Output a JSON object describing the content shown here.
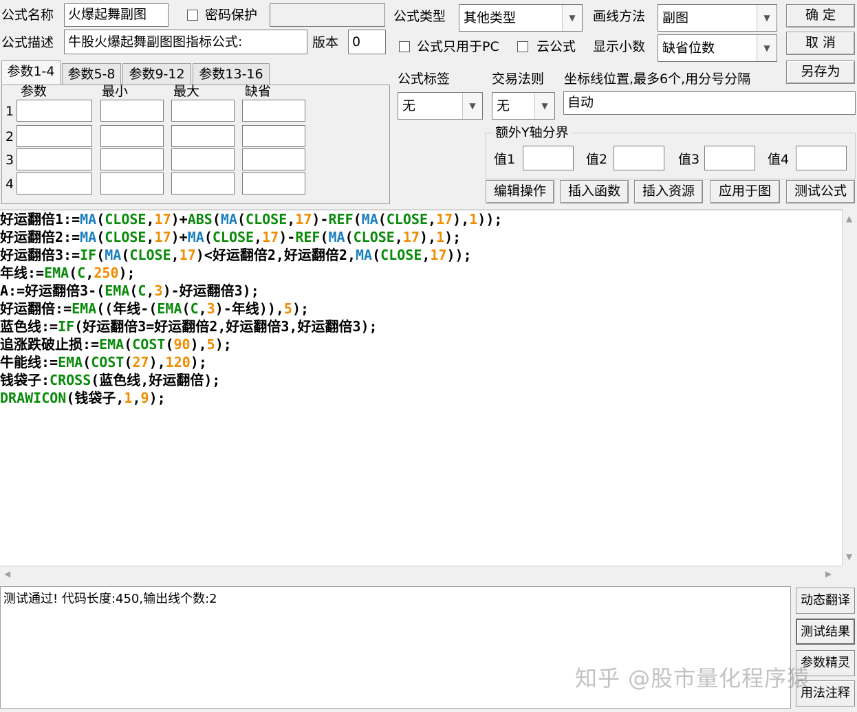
{
  "top": {
    "name_label": "公式名称",
    "name_value": "火爆起舞副图",
    "password_label": "密码保护",
    "password_value": "",
    "desc_label": "公式描述",
    "desc_value": "牛股火爆起舞副图图指标公式:",
    "version_label": "版本",
    "version_value": "0",
    "type_label": "公式类型",
    "type_value": "其他类型",
    "draw_label": "画线方法",
    "draw_value": "副图",
    "pc_only_label": "公式只用于PC",
    "cloud_label": "云公式",
    "decimals_label": "显示小数",
    "decimals_value": "缺省位数",
    "ok_label": "确 定",
    "cancel_label": "取 消",
    "saveas_label": "另存为"
  },
  "tabs": [
    "参数1-4",
    "参数5-8",
    "参数9-12",
    "参数13-16"
  ],
  "params": {
    "headers": [
      "参数",
      "最小",
      "最大",
      "缺省"
    ],
    "rows": [
      "1",
      "2",
      "3",
      "4"
    ]
  },
  "right": {
    "tag_label": "公式标签",
    "tag_value": "无",
    "trade_label": "交易法则",
    "trade_value": "无",
    "coord_label": "坐标线位置,最多6个,用分号分隔",
    "coord_value": "自动",
    "extra_y_label": "额外Y轴分界",
    "v1": "值1",
    "v2": "值2",
    "v3": "值3",
    "v4": "值4"
  },
  "actions": [
    "编辑操作",
    "插入函数",
    "插入资源",
    "应用于图",
    "测试公式"
  ],
  "code_lines": [
    [
      [
        "t",
        "好运翻倍1:="
      ],
      [
        "f2",
        "MA"
      ],
      [
        "t",
        "("
      ],
      [
        "f",
        "CLOSE"
      ],
      [
        "t",
        ","
      ],
      [
        "n",
        "17"
      ],
      [
        "t",
        ")+"
      ],
      [
        "f",
        "ABS"
      ],
      [
        "t",
        "("
      ],
      [
        "f2",
        "MA"
      ],
      [
        "t",
        "("
      ],
      [
        "f",
        "CLOSE"
      ],
      [
        "t",
        ","
      ],
      [
        "n",
        "17"
      ],
      [
        "t",
        ")-"
      ],
      [
        "f",
        "REF"
      ],
      [
        "t",
        "("
      ],
      [
        "f2",
        "MA"
      ],
      [
        "t",
        "("
      ],
      [
        "f",
        "CLOSE"
      ],
      [
        "t",
        ","
      ],
      [
        "n",
        "17"
      ],
      [
        "t",
        "),"
      ],
      [
        "n",
        "1"
      ],
      [
        "t",
        "));"
      ]
    ],
    [
      [
        "t",
        "好运翻倍2:="
      ],
      [
        "f2",
        "MA"
      ],
      [
        "t",
        "("
      ],
      [
        "f",
        "CLOSE"
      ],
      [
        "t",
        ","
      ],
      [
        "n",
        "17"
      ],
      [
        "t",
        ")+"
      ],
      [
        "f2",
        "MA"
      ],
      [
        "t",
        "("
      ],
      [
        "f",
        "CLOSE"
      ],
      [
        "t",
        ","
      ],
      [
        "n",
        "17"
      ],
      [
        "t",
        ")-"
      ],
      [
        "f",
        "REF"
      ],
      [
        "t",
        "("
      ],
      [
        "f2",
        "MA"
      ],
      [
        "t",
        "("
      ],
      [
        "f",
        "CLOSE"
      ],
      [
        "t",
        ","
      ],
      [
        "n",
        "17"
      ],
      [
        "t",
        "),"
      ],
      [
        "n",
        "1"
      ],
      [
        "t",
        ");"
      ]
    ],
    [
      [
        "t",
        "好运翻倍3:="
      ],
      [
        "f",
        "IF"
      ],
      [
        "t",
        "("
      ],
      [
        "f2",
        "MA"
      ],
      [
        "t",
        "("
      ],
      [
        "f",
        "CLOSE"
      ],
      [
        "t",
        ","
      ],
      [
        "n",
        "17"
      ],
      [
        "t",
        ")<好运翻倍2,好运翻倍2,"
      ],
      [
        "f2",
        "MA"
      ],
      [
        "t",
        "("
      ],
      [
        "f",
        "CLOSE"
      ],
      [
        "t",
        ","
      ],
      [
        "n",
        "17"
      ],
      [
        "t",
        "));"
      ]
    ],
    [
      [
        "t",
        "年线:="
      ],
      [
        "f",
        "EMA"
      ],
      [
        "t",
        "("
      ],
      [
        "f",
        "C"
      ],
      [
        "t",
        ","
      ],
      [
        "n",
        "250"
      ],
      [
        "t",
        ");"
      ]
    ],
    [
      [
        "t",
        "A:=好运翻倍3-("
      ],
      [
        "f",
        "EMA"
      ],
      [
        "t",
        "("
      ],
      [
        "f",
        "C"
      ],
      [
        "t",
        ","
      ],
      [
        "n",
        "3"
      ],
      [
        "t",
        ")-好运翻倍3);"
      ]
    ],
    [
      [
        "t",
        "好运翻倍:="
      ],
      [
        "f",
        "EMA"
      ],
      [
        "t",
        "((年线-("
      ],
      [
        "f",
        "EMA"
      ],
      [
        "t",
        "("
      ],
      [
        "f",
        "C"
      ],
      [
        "t",
        ","
      ],
      [
        "n",
        "3"
      ],
      [
        "t",
        ")-年线)),"
      ],
      [
        "n",
        "5"
      ],
      [
        "t",
        ");"
      ]
    ],
    [
      [
        "t",
        "蓝色线:="
      ],
      [
        "f",
        "IF"
      ],
      [
        "t",
        "(好运翻倍3=好运翻倍2,好运翻倍3,好运翻倍3);"
      ]
    ],
    [
      [
        "t",
        "追涨跌破止损:="
      ],
      [
        "f",
        "EMA"
      ],
      [
        "t",
        "("
      ],
      [
        "f",
        "COST"
      ],
      [
        "t",
        "("
      ],
      [
        "n",
        "90"
      ],
      [
        "t",
        "),"
      ],
      [
        "n",
        "5"
      ],
      [
        "t",
        ");"
      ]
    ],
    [
      [
        "t",
        "牛能线:="
      ],
      [
        "f",
        "EMA"
      ],
      [
        "t",
        "("
      ],
      [
        "f",
        "COST"
      ],
      [
        "t",
        "("
      ],
      [
        "n",
        "27"
      ],
      [
        "t",
        "),"
      ],
      [
        "n",
        "120"
      ],
      [
        "t",
        ");"
      ]
    ],
    [
      [
        "t",
        "钱袋子:"
      ],
      [
        "f",
        "CROSS"
      ],
      [
        "t",
        "(蓝色线,好运翻倍);"
      ]
    ],
    [
      [
        "f",
        "DRAWICON"
      ],
      [
        "t",
        "(钱袋子,"
      ],
      [
        "n",
        "1"
      ],
      [
        "t",
        ","
      ],
      [
        "n",
        "9"
      ],
      [
        "t",
        ");"
      ]
    ]
  ],
  "output_text": "测试通过! 代码长度:450,输出线个数:2",
  "side_buttons": [
    "动态翻译",
    "测试结果",
    "参数精灵",
    "用法注释"
  ],
  "watermark": "知乎 @股市量化程序猿",
  "colors": {
    "number": "#f08c00",
    "function": "#0a8a0a",
    "ma_function": "#1a7fc0",
    "background": "#f0f0f0"
  }
}
